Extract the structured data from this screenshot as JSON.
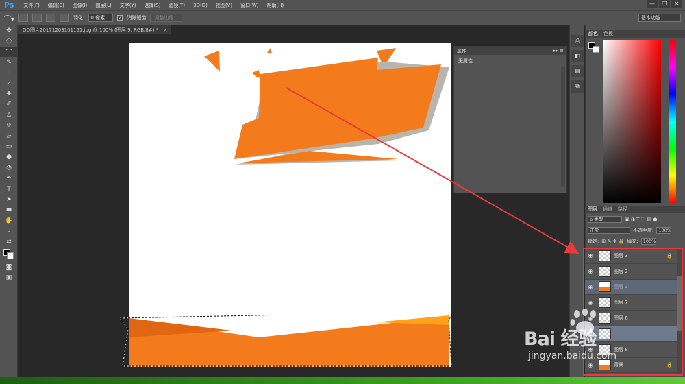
{
  "app": {
    "logo": "Ps"
  },
  "menu": [
    "文件(F)",
    "编辑(E)",
    "图像(I)",
    "图层(L)",
    "文字(Y)",
    "选择(S)",
    "滤镜(T)",
    "3D(D)",
    "视图(V)",
    "窗口(W)",
    "帮助(H)"
  ],
  "window_controls": [
    "—",
    "❐",
    "✕"
  ],
  "options_bar": {
    "feather_label": "羽化:",
    "feather_value": "0 像素",
    "antialias_label": "消除锯齿",
    "antialias_checked": "✓",
    "refine_edge": "调整边缘...",
    "workspace": "基本功能"
  },
  "document": {
    "tab_title": "QQ图片20171203101151.jpg @ 100% (图层 9, RGB/8#) *",
    "tab_close": "×"
  },
  "properties_panel": {
    "title": "属性",
    "content": "无属性"
  },
  "color_panel": {
    "tabs": [
      "颜色",
      "色板"
    ]
  },
  "layers_panel": {
    "tabs": [
      "图层",
      "通道",
      "路径"
    ],
    "filter_kind": "ρ 类型",
    "blend_mode": "正常",
    "opacity_label": "不透明度:",
    "opacity_value": "100%",
    "lock_label": "锁定:",
    "fill_label": "填充:",
    "fill_value": "100%",
    "layers": [
      {
        "name": "图层 3",
        "state": "normal",
        "locked": true
      },
      {
        "name": "图层 2",
        "state": "normal",
        "locked": false
      },
      {
        "name": "图层 3",
        "state": "dragging",
        "locked": false
      },
      {
        "name": "图层 7",
        "state": "normal",
        "locked": false
      },
      {
        "name": "图层 6",
        "state": "normal",
        "locked": false
      },
      {
        "name": "",
        "state": "selected",
        "locked": false
      },
      {
        "name": "图层 8",
        "state": "normal",
        "locked": false
      },
      {
        "name": "背景",
        "state": "normal",
        "locked": true
      }
    ]
  },
  "watermark": {
    "brand": "Bai  经验",
    "url": "jingyan.baidu.com"
  },
  "colors": {
    "accent_orange": "#f47b1b",
    "shadow_grey": "#b9b5ad",
    "annotation_red": "#e83a3a"
  }
}
